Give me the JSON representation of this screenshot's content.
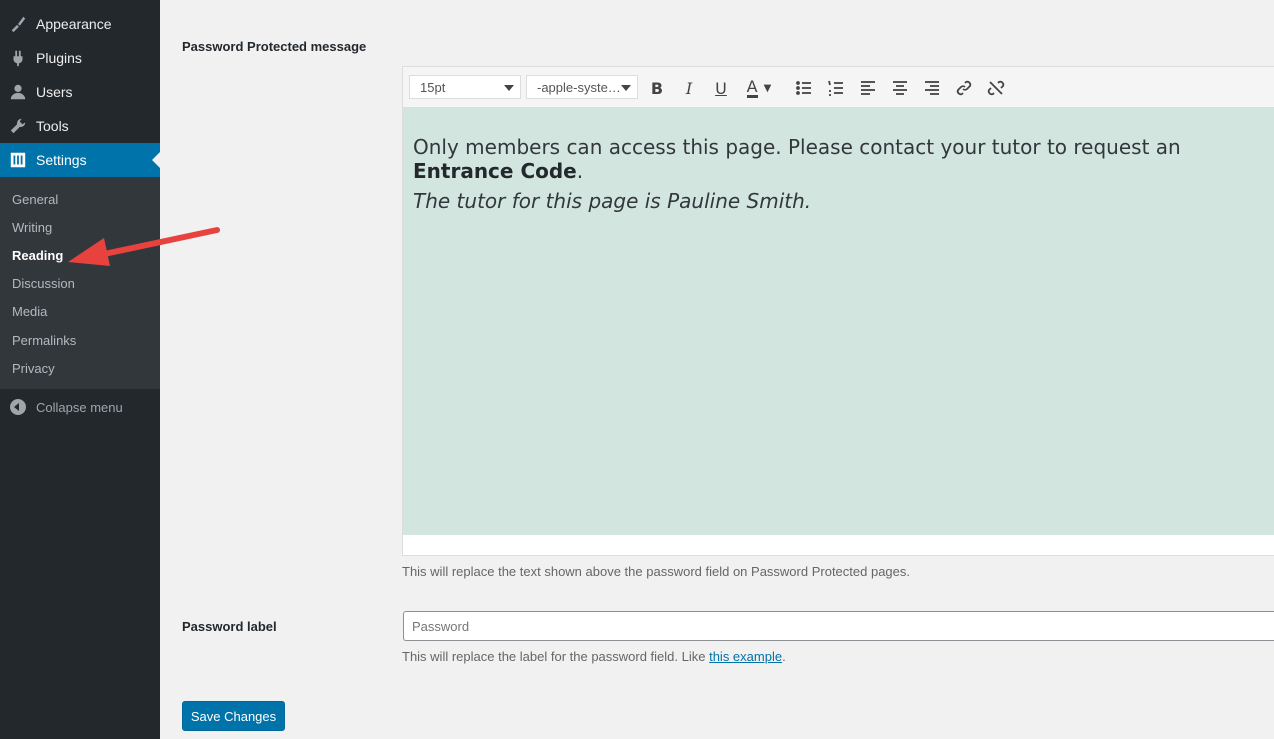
{
  "sidebar": {
    "menu": [
      {
        "label": "Appearance",
        "icon": "paintbrush-icon"
      },
      {
        "label": "Plugins",
        "icon": "plugin-icon"
      },
      {
        "label": "Users",
        "icon": "user-icon"
      },
      {
        "label": "Tools",
        "icon": "wrench-icon"
      },
      {
        "label": "Settings",
        "icon": "settings-sliders-icon"
      }
    ],
    "submenu": [
      "General",
      "Writing",
      "Reading",
      "Discussion",
      "Media",
      "Permalinks",
      "Privacy"
    ],
    "active_submenu": "Reading",
    "collapse_label": "Collapse menu"
  },
  "form": {
    "message_label": "Password Protected message",
    "font_size": "15pt",
    "font_family": "-apple-syste…",
    "content_line1_text": "Only members can access this page. Please contact your tutor to request an ",
    "content_line1_bold": "Entrance Code",
    "content_line1_end": ".",
    "content_line2": "The tutor for this page is Pauline Smith.",
    "message_description": "This will replace the text shown above the password field on Password Protected pages.",
    "password_label": "Password label",
    "password_placeholder": "Password",
    "password_description": "This will replace the label for the password field. Like ",
    "password_link": "this example",
    "password_description_end": ".",
    "save_label": "Save Changes"
  },
  "colors": {
    "sidebar_bg": "#23282d",
    "accent": "#0073aa",
    "editor_bg": "#d3e5df",
    "annotation_arrow": "#e8423f"
  }
}
